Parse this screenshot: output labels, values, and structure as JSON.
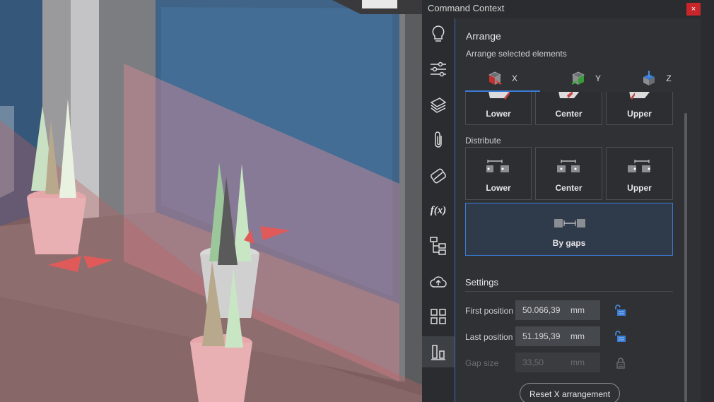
{
  "panel": {
    "title": "Command Context",
    "close_label": "×"
  },
  "sidebar": {
    "icons": [
      "lightbulb-icon",
      "sliders-icon",
      "layers-icon",
      "paperclip-icon",
      "materials-icon",
      "function-icon",
      "tree-icon",
      "cloud-upload-icon",
      "grid-icon",
      "align-icon"
    ],
    "function_label": "f(x)"
  },
  "arrange": {
    "heading": "Arrange",
    "subtitle": "Arrange selected elements",
    "tabs": [
      {
        "label": "X",
        "icon": "axis-x-cube-icon",
        "color": "#d23a3a",
        "active": true
      },
      {
        "label": "Y",
        "icon": "axis-y-cube-icon",
        "color": "#3aa53a",
        "active": false
      },
      {
        "label": "Z",
        "icon": "axis-z-cube-icon",
        "color": "#3a7bd5",
        "active": false
      }
    ],
    "align_buttons": [
      "Lower",
      "Center",
      "Upper"
    ],
    "distribute_label": "Distribute",
    "distribute_buttons": [
      "Lower",
      "Center",
      "Upper"
    ],
    "by_gaps_label": "By gaps"
  },
  "settings": {
    "heading": "Settings",
    "fields": [
      {
        "label": "First position",
        "value": "50.066,39",
        "unit": "mm",
        "disabled": false
      },
      {
        "label": "Last position",
        "value": "51.195,39",
        "unit": "mm",
        "disabled": false
      },
      {
        "label": "Gap size",
        "value": "33,50",
        "unit": "mm",
        "disabled": true
      }
    ],
    "reset_label": "Reset X arrangement"
  },
  "colors": {
    "accent": "#3a7bd5",
    "close": "#c8262b"
  }
}
